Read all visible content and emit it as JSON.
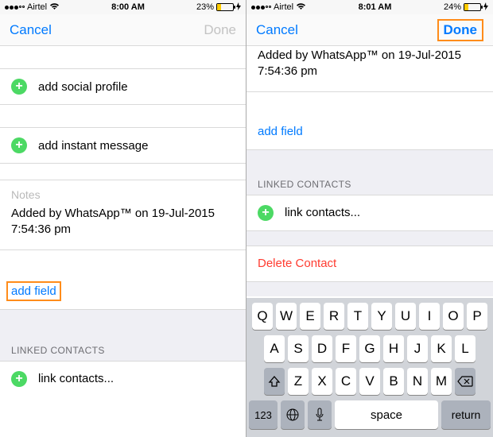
{
  "left": {
    "status": {
      "carrier": "Airtel",
      "time": "8:00 AM",
      "battery": "23%"
    },
    "nav": {
      "cancel": "Cancel",
      "done": "Done"
    },
    "rows": {
      "social": "add social profile",
      "im": "add instant message",
      "notes_label": "Notes",
      "notes_text": "Added by WhatsApp™ on 19-Jul-2015 7:54:36 pm",
      "add_field": "add field",
      "linked_header": "LINKED CONTACTS",
      "link_contacts": "link contacts..."
    }
  },
  "right": {
    "status": {
      "carrier": "Airtel",
      "time": "8:01 AM",
      "battery": "24%"
    },
    "nav": {
      "cancel": "Cancel",
      "done": "Done"
    },
    "rows": {
      "notes_text": "Added by WhatsApp™ on 19-Jul-2015 7:54:36 pm",
      "add_field": "add field",
      "linked_header": "LINKED CONTACTS",
      "link_contacts": "link contacts...",
      "delete": "Delete Contact"
    },
    "kbd": {
      "r1": [
        "Q",
        "W",
        "E",
        "R",
        "T",
        "Y",
        "U",
        "I",
        "O",
        "P"
      ],
      "r2": [
        "A",
        "S",
        "D",
        "F",
        "G",
        "H",
        "J",
        "K",
        "L"
      ],
      "r3": [
        "Z",
        "X",
        "C",
        "V",
        "B",
        "N",
        "M"
      ],
      "num": "123",
      "space": "space",
      "ret": "return"
    }
  }
}
